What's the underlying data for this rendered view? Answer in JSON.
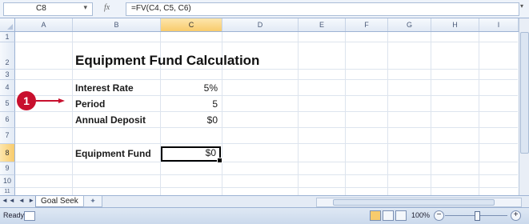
{
  "formula_bar": {
    "name_box": "C8",
    "fx_label": "fx",
    "formula": "=FV(C4, C5, C6)"
  },
  "columns": [
    "A",
    "B",
    "C",
    "D",
    "E",
    "F",
    "G",
    "H",
    "I"
  ],
  "selected_column": "C",
  "rows": [
    "1",
    "2",
    "3",
    "4",
    "5",
    "6",
    "7",
    "8",
    "9",
    "10",
    "11"
  ],
  "selected_row": "8",
  "sheet": {
    "title": "Equipment Fund Calculation",
    "interest_rate_label": "Interest Rate",
    "interest_rate_value": "5%",
    "period_label": "Period",
    "period_value": "5",
    "annual_deposit_label": "Annual Deposit",
    "annual_deposit_value": "$0",
    "equipment_fund_label": "Equipment Fund",
    "equipment_fund_value": "$0"
  },
  "callout": {
    "number": "1",
    "color": "#c8102e"
  },
  "tabs": {
    "sheet_name": "Goal Seek"
  },
  "status": {
    "ready": "Ready",
    "zoom": "100%"
  }
}
